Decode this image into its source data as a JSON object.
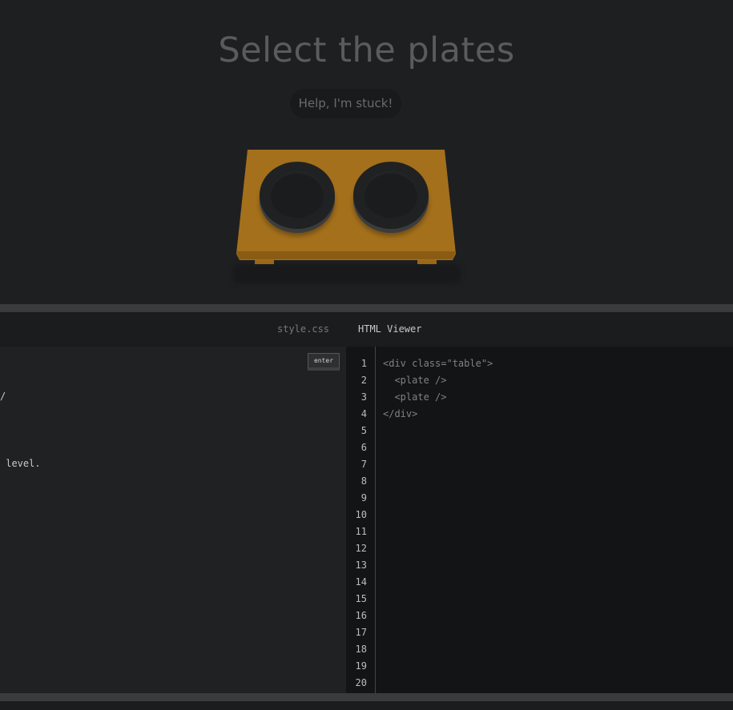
{
  "game": {
    "title": "Select the plates",
    "help_label": "Help, I'm stuck!"
  },
  "tabs": {
    "css_label": "style.css",
    "html_label": "HTML Viewer"
  },
  "css_editor": {
    "enter_label": "enter",
    "visible_lines": [
      "/",
      " level."
    ]
  },
  "html_viewer": {
    "line_numbers": [
      "1",
      "2",
      "3",
      "4",
      "5",
      "6",
      "7",
      "8",
      "9",
      "10",
      "11",
      "12",
      "13",
      "14",
      "15",
      "16",
      "17",
      "18",
      "19",
      "20"
    ],
    "code_lines": [
      "<div class=\"table\">",
      "  <plate />",
      "  <plate />",
      "</div>"
    ]
  },
  "colors": {
    "background": "#1e1f21",
    "table": "#a4701c",
    "plate": "#202122",
    "divider": "#3a3b3d"
  }
}
